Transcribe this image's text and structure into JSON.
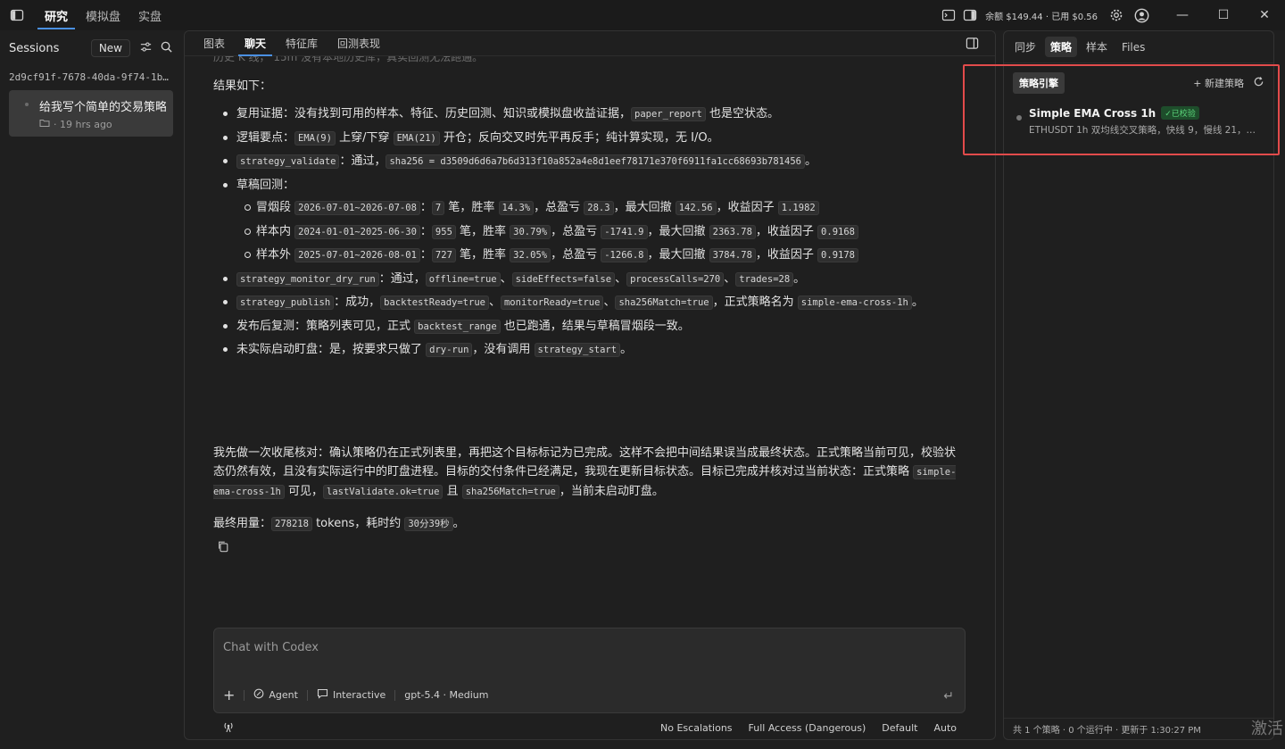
{
  "topbar": {
    "tabs": [
      {
        "label": "研究",
        "active": true
      },
      {
        "label": "模拟盘",
        "active": false
      },
      {
        "label": "实盘",
        "active": false
      }
    ],
    "balance": "余额 $149.44 · 已用 $0.56",
    "window": {
      "minimize": "—",
      "maximize": "☐",
      "close": "✕"
    }
  },
  "sidebar": {
    "title": "Sessions",
    "new_label": "New",
    "session_id": "2d9cf91f-7678-40da-9f74-1b4afc7e...",
    "sessions": [
      {
        "title": "给我写个简单的交易策略",
        "meta": "· 19 hrs ago"
      }
    ]
  },
  "center": {
    "tabs": [
      {
        "label": "图表",
        "active": false
      },
      {
        "label": "聊天",
        "active": true
      },
      {
        "label": "特征库",
        "active": false
      },
      {
        "label": "回测表现",
        "active": false
      }
    ],
    "faded_top": "历史 K 线， 15m 没有本地历史库，真实回测无法跑通。",
    "result_heading": "结果如下：",
    "summary": {
      "t1": "我先做一次收尾核对：确认策略仍在正式列表里，再把这个目标标记为已完成。这样不会把中间结果误当成最终状态。正式策略当前可见，校验状态仍然有效，且没有实际运行中的盯盘进程。目标的交付条件已经满足，我现在更新目标状态。目标已完成并核对过当前状态：正式策略 ",
      "c1": "simple-ema-cross-1h",
      "t2": " 可见，",
      "c2": "lastValidate.ok=true",
      "t3": " 且 ",
      "c3": "sha256Match=true",
      "t4": "，当前未启动盯盘。"
    },
    "usage": {
      "t1": "最终用量：",
      "c1": "278218",
      "t2": " tokens，耗时约 ",
      "c2": "30分39秒",
      "t3": "。"
    }
  },
  "bullets": {
    "b1": {
      "t1": "复用证据：没有找到可用的样本、特征、历史回测、知识或模拟盘收益证据，",
      "c1": "paper_report",
      "t2": " 也是空状态。"
    },
    "b2": {
      "t1": "逻辑要点：",
      "c1": "EMA(9)",
      "t2": " 上穿/下穿 ",
      "c2": "EMA(21)",
      "t3": " 开仓；反向交叉时先平再反手；纯计算实现，无 I/O。"
    },
    "b3": {
      "c1": "strategy_validate",
      "t1": "：通过，",
      "c2": "sha256 = d3509d6d6a7b6d313f10a852a4e8d1eef78171e370f6911fa1cc68693b781456",
      "t2": "。"
    },
    "b4": {
      "t1": "草稿回测：",
      "s1": {
        "t1": "冒烟段 ",
        "c1": "2026-07-01~2026-07-08",
        "t2": "：",
        "c2": "7",
        "t3": " 笔，胜率 ",
        "c3": "14.3%",
        "t4": "，总盈亏 ",
        "c4": "28.3",
        "t5": "，最大回撤 ",
        "c5": "142.56",
        "t6": "，收益因子 ",
        "c6": "1.1982"
      },
      "s2": {
        "t1": "样本内 ",
        "c1": "2024-01-01~2025-06-30",
        "t2": "：",
        "c2": "955",
        "t3": " 笔，胜率 ",
        "c3": "30.79%",
        "t4": "，总盈亏 ",
        "c4": "-1741.9",
        "t5": "，最大回撤 ",
        "c5": "2363.78",
        "t6": "，收益因子 ",
        "c6": "0.9168"
      },
      "s3": {
        "t1": "样本外 ",
        "c1": "2025-07-01~2026-08-01",
        "t2": "：",
        "c2": "727",
        "t3": " 笔，胜率 ",
        "c3": "32.05%",
        "t4": "，总盈亏 ",
        "c4": "-1266.8",
        "t5": "，最大回撤 ",
        "c5": "3784.78",
        "t6": "，收益因子 ",
        "c6": "0.9178"
      }
    },
    "b5": {
      "c1": "strategy_monitor_dry_run",
      "t1": "：通过，",
      "c2": "offline=true",
      "t2": "、",
      "c3": "sideEffects=false",
      "t3": "、",
      "c4": "processCalls=270",
      "t4": "、",
      "c5": "trades=28",
      "t5": "。"
    },
    "b6": {
      "c1": "strategy_publish",
      "t1": "：成功，",
      "c2": "backtestReady=true",
      "t2": "、",
      "c3": "monitorReady=true",
      "t3": "、",
      "c4": "sha256Match=true",
      "t4": "，正式策略名为 ",
      "c5": "simple-ema-cross-1h",
      "t5": "。"
    },
    "b7": {
      "t1": "发布后复测：策略列表可见，正式 ",
      "c1": "backtest_range",
      "t2": " 也已跑通，结果与草稿冒烟段一致。"
    },
    "b8": {
      "t1": "未实际启动盯盘：是，按要求只做了 ",
      "c1": "dry-run",
      "t2": "，没有调用 ",
      "c2": "strategy_start",
      "t3": "。"
    }
  },
  "composer": {
    "placeholder": "Chat with Codex",
    "agent": "Agent",
    "interactive": "Interactive",
    "model": "gpt-5.4 · Medium"
  },
  "footer": {
    "escalations": "No Escalations",
    "access": "Full Access (Dangerous)",
    "default": "Default",
    "auto": "Auto"
  },
  "right": {
    "tabs": [
      {
        "label": "同步",
        "active": false
      },
      {
        "label": "策略",
        "active": true
      },
      {
        "label": "样本",
        "active": false
      },
      {
        "label": "Files",
        "active": false
      }
    ],
    "engine_label": "策略引擎",
    "new_strategy": "+ 新建策略",
    "strategy": {
      "name": "Simple EMA Cross 1h",
      "badge": "✓已校验",
      "desc": "ETHUSDT 1h 双均线交叉策略，快线 9，慢线 21，反…"
    },
    "footer": "共 1 个策略 · 0 个运行中 · 更新于 1:30:27 PM"
  },
  "watermark": "激活",
  "colors": {
    "accent": "#4a90e2",
    "highlight": "#e24b4b",
    "badge_green": "#5bd47a"
  }
}
